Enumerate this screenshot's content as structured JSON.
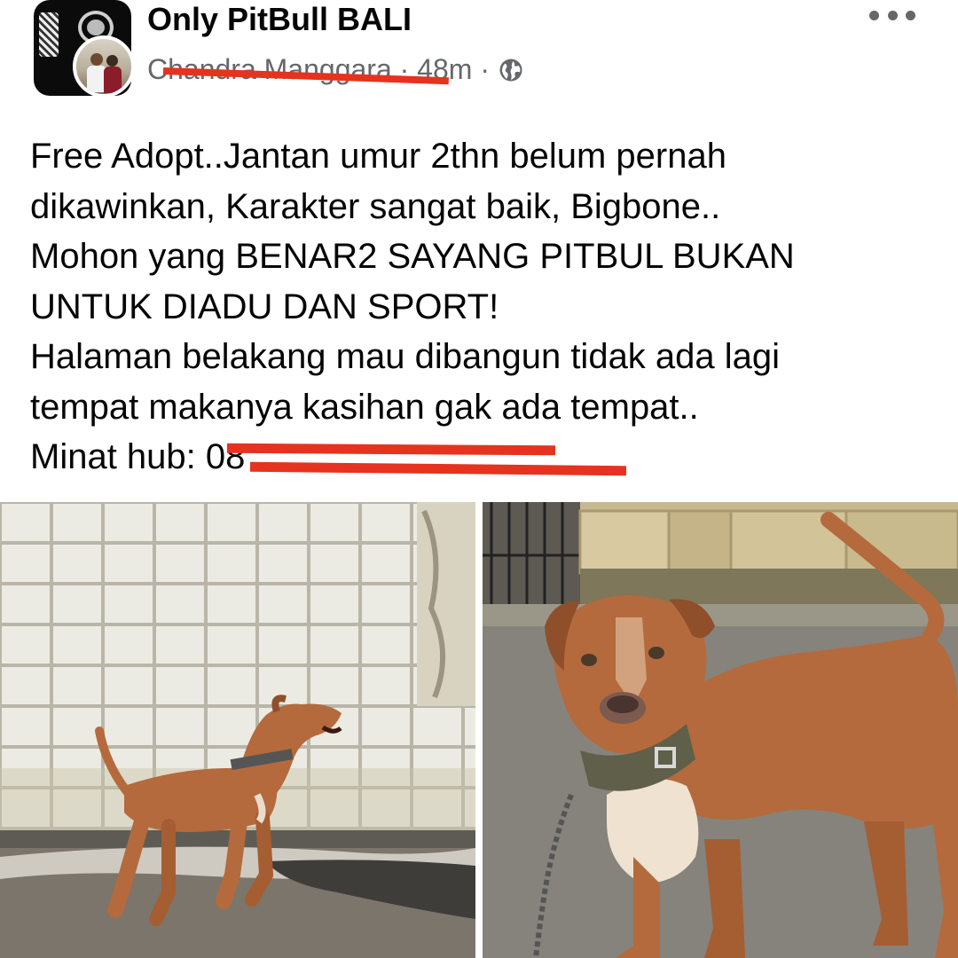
{
  "post": {
    "group_name": "Only PitBull BALI",
    "author": "Chandra Manggara",
    "separator": " · ",
    "time": "48m",
    "separator2": " · ",
    "privacy_icon": "globe-icon",
    "more_icon": "more-dots-icon",
    "text_lines": [
      "Free Adopt..Jantan umur 2thn belum pernah",
      "dikawinkan, Karakter sangat baik, Bigbone..",
      "Mohon yang BENAR2 SAYANG PITBUL BUKAN",
      "UNTUK DIADU DAN SPORT!",
      "Halaman belakang mau dibangun tidak ada lagi",
      "tempat makanya kasihan gak ada tempat..",
      "Minat hub: 08"
    ]
  },
  "colors": {
    "redaction": "#e5331f",
    "meta_text": "#65676b",
    "dog_brown": "#b46a3c"
  }
}
